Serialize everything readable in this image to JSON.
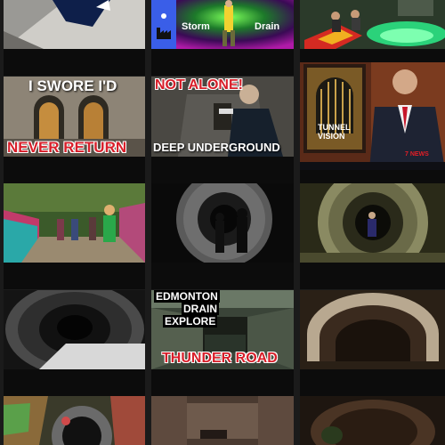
{
  "tiles": {
    "r1c2": {
      "left": "Storm",
      "right": "Drain"
    },
    "r2c1": {
      "top": "I SWORE I'D",
      "bottom": "NEVER RETURN"
    },
    "r2c2": {
      "top": "NOT ALONE!",
      "bottom": "DEEP UNDERGROUND"
    },
    "r2c3": {
      "caption": "TUNNEL VISION",
      "channel": "7 NEWS"
    },
    "r4c2": {
      "line1": "EDMONTON",
      "line2": "DRAIN",
      "line3": "EXPLORE",
      "bottom": "THUNDER ROAD"
    }
  },
  "colors": {
    "page_bg": "#1b1b1b",
    "strip": "#0c0c0c",
    "headline_red": "#d81f2a",
    "storm_pink": "#ff3fd2"
  }
}
